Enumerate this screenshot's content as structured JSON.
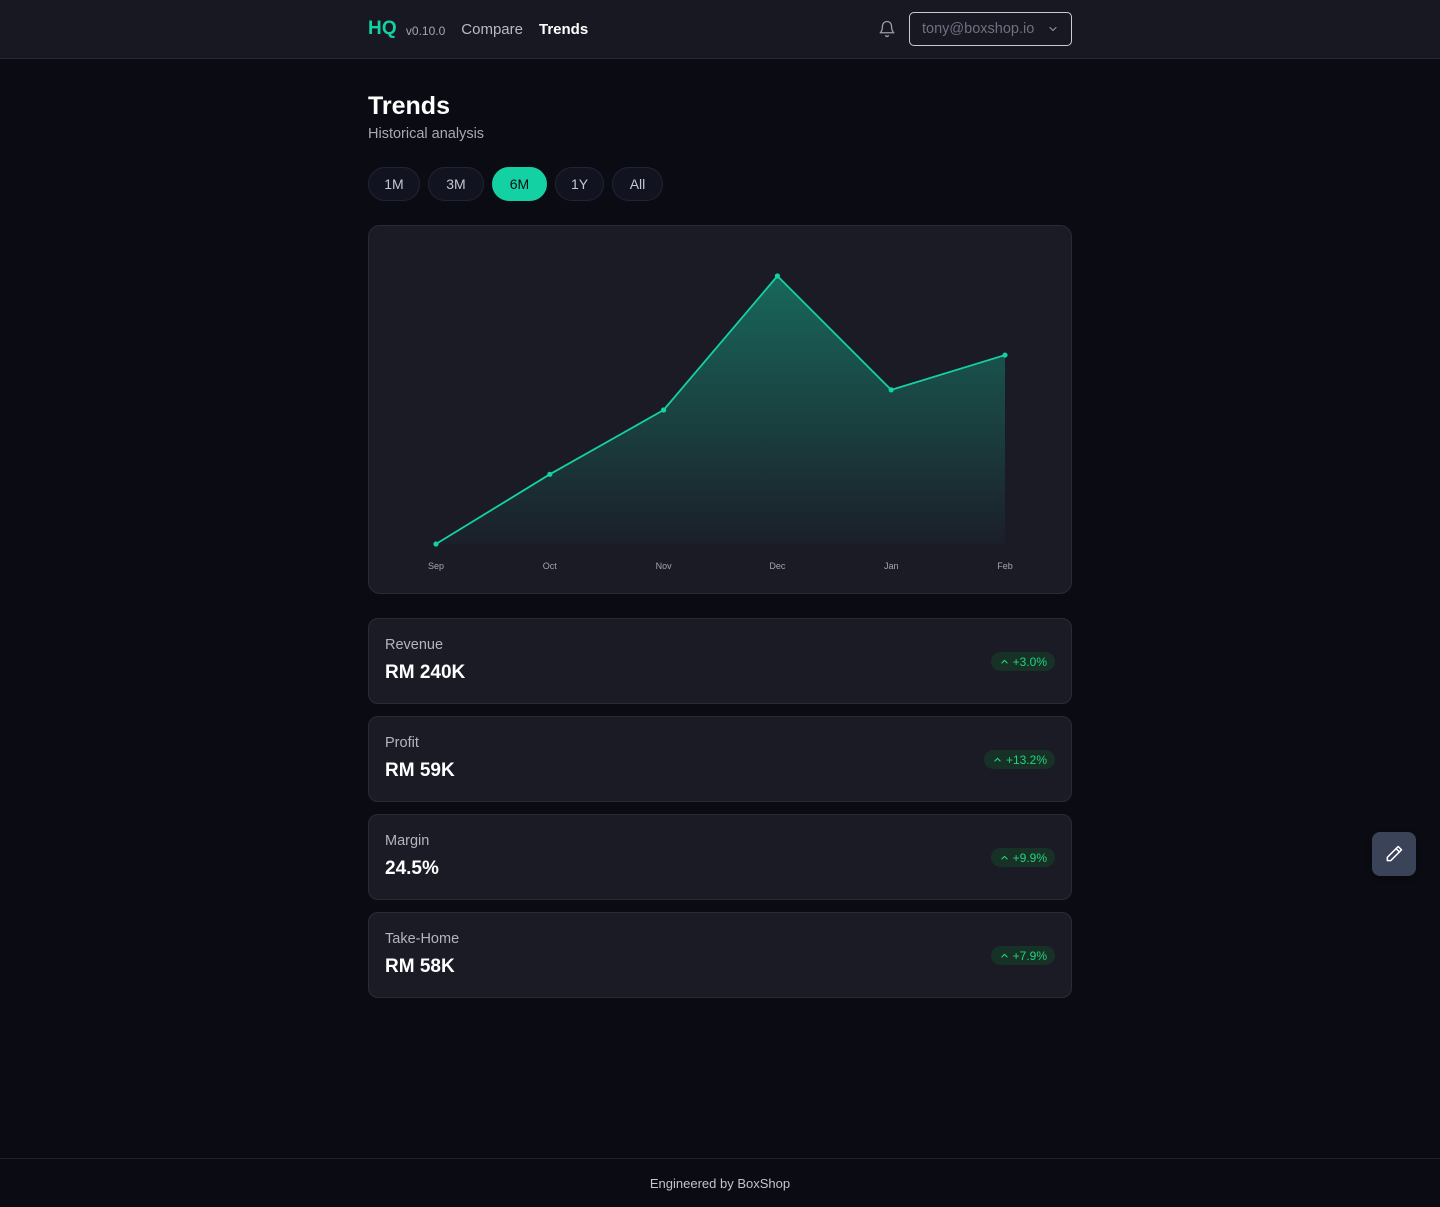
{
  "app": {
    "logo": "HQ",
    "version": "v0.10.0",
    "nav": [
      {
        "label": "Compare",
        "active": false
      },
      {
        "label": "Trends",
        "active": true
      }
    ],
    "account": "tony@boxshop.io"
  },
  "page": {
    "title": "Trends",
    "subtitle": "Historical analysis"
  },
  "ranges": {
    "options": [
      "1M",
      "3M",
      "6M",
      "1Y",
      "All"
    ],
    "selected": "6M"
  },
  "chart_data": {
    "type": "area",
    "categories": [
      "Sep",
      "Oct",
      "Nov",
      "Dec",
      "Jan",
      "Feb"
    ],
    "series": [
      {
        "values": [
          0,
          26,
          50,
          100,
          57.5,
          70.5
        ]
      }
    ],
    "ylim": [
      0,
      100
    ],
    "grid": false,
    "color": "#14d1a4"
  },
  "metrics": [
    {
      "label": "Revenue",
      "value": "RM 240K",
      "change": "+3.0%"
    },
    {
      "label": "Profit",
      "value": "RM 59K",
      "change": "+13.2%"
    },
    {
      "label": "Margin",
      "value": "24.5%",
      "change": "+9.9%"
    },
    {
      "label": "Take-Home",
      "value": "RM 58K",
      "change": "+7.9%"
    }
  ],
  "colors": {
    "accent": "#14d1a4",
    "positive": "#21d37f",
    "background": "#0b0c13",
    "card": "#1b1b26"
  },
  "footer": {
    "text": "Engineered by BoxShop"
  }
}
